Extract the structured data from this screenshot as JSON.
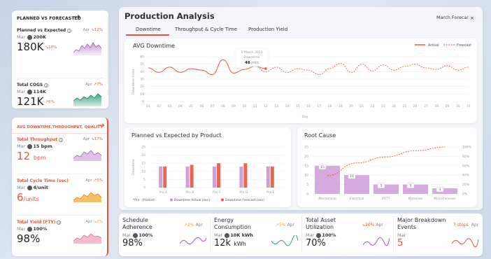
{
  "left": {
    "card1": {
      "title": "PLANNED VS FORECASTED",
      "kpis": [
        {
          "name": "Planned vs Expected",
          "apr_label": "Apr",
          "apr_change": "12%",
          "mar_label": "Mar",
          "mar_value": "200K",
          "value": "180K",
          "value_change": "10%"
        },
        {
          "name": "Total COGS",
          "apr_label": "Apr",
          "apr_change": "7%",
          "mar_label": "Mar",
          "mar_value": "114K",
          "value": "121K",
          "value_change": "6%"
        }
      ]
    },
    "card2": {
      "title": "AVG DOWNTIME,THROUGHPUT, QUALITY",
      "kpis": [
        {
          "name": "Total Throughput",
          "apr_label": "Apr",
          "apr_change": "17%",
          "mar_label": "Mar",
          "mar_value": "15 bpm",
          "value": "12",
          "unit": "bpm"
        },
        {
          "name": "Total Cycle Time (sec)",
          "apr_label": "Apr",
          "apr_change": "5%",
          "mar_label": "Mar",
          "mar_value": "4/unit",
          "value": "6",
          "unit": "/units"
        },
        {
          "name": "Total Yield (FTY)",
          "apr_label": "Apr",
          "apr_change": "2%",
          "mar_label": "Mar",
          "mar_value": "100%",
          "value": "98%"
        }
      ]
    }
  },
  "main": {
    "title": "Production Analysis",
    "forecast_label": "March Forecast",
    "close_icon": "×",
    "tabs": [
      {
        "label": "Downtime"
      },
      {
        "label": "Throughput & Cycle Time"
      },
      {
        "label": "Production Yield"
      }
    ]
  },
  "downtime_chart": {
    "title": "AVG Downtime",
    "legend_actual": "Actual",
    "legend_forecast": "Forecast",
    "tooltip_date": "5 March 2023",
    "tooltip_label": "Downtime",
    "tooltip_value": "48",
    "tooltip_unit": "min",
    "ylabel": "Downtime (min)",
    "xlabel": "Day"
  },
  "product_chart": {
    "title": "Planned vs Expected by Product",
    "ylabel": "Downtime",
    "footnote": "*Pro - Product",
    "legend_actual": "Downtime Actual (sec)",
    "legend_forecast": "Downtime Forecast (sec)"
  },
  "root_chart": {
    "title": "Root Cause"
  },
  "bottom": [
    {
      "title": "Schedule Adherence",
      "apr_change": "2%",
      "apr_label": "Apr",
      "mar_label": "Mar",
      "mar_value": "100%",
      "value": "98%"
    },
    {
      "title": "Energy Consumption",
      "apr_change": "5%",
      "apr_label": "Apr",
      "mar_label": "Mar",
      "mar_value": "10K kWh",
      "value": "12k",
      "unit": "kWh"
    },
    {
      "title": "Total Asset Utilization",
      "apr_change": "20%",
      "apr_label": "Apr",
      "mar_label": "Mar",
      "mar_value": "100%",
      "value": "70%"
    },
    {
      "title": "Major Breakdown Events",
      "apr_change": "7 stops",
      "apr_label": "Apr",
      "mar_label": "Mar",
      "mar_value": "",
      "value": "5"
    }
  ],
  "colors": {
    "accent": "#e8553e",
    "purple": "#c58fd0",
    "green": "#2e9f7a",
    "orange": "#f2a22a",
    "pink": "#f0a0b0"
  },
  "chart_data": [
    {
      "type": "line",
      "title": "AVG Downtime",
      "xlabel": "Day",
      "ylabel": "Downtime (min)",
      "x": [
        "01",
        "02",
        "03",
        "04",
        "05",
        "06",
        "07",
        "08",
        "09",
        "10",
        "11",
        "12",
        "13",
        "14",
        "15",
        "16",
        "17",
        "18",
        "19",
        "20",
        "21",
        "22",
        "23",
        "24",
        "25",
        "26",
        "27",
        "28",
        "29",
        "30",
        "31"
      ],
      "ylim": [
        0,
        60
      ],
      "yticks": [
        0,
        10,
        20,
        30,
        40,
        50,
        60
      ],
      "series": [
        {
          "name": "Actual",
          "values": [
            45,
            39,
            46,
            39,
            44,
            42,
            36,
            56,
            38,
            43,
            47,
            44
          ]
        },
        {
          "name": "Forecast",
          "values": [
            null,
            null,
            null,
            null,
            null,
            null,
            null,
            null,
            null,
            null,
            47,
            40,
            46,
            39,
            44,
            42,
            36,
            44,
            51,
            39,
            50,
            41,
            49,
            42,
            47,
            50,
            45,
            43,
            48,
            42,
            46
          ]
        }
      ],
      "legend": "top-right"
    },
    {
      "type": "bar",
      "title": "Planned vs Expected by Product",
      "ylabel": "Downtime",
      "categories": [
        "Pro A",
        "Pro B",
        "Pro C",
        "Pro D",
        "Pro E"
      ],
      "ylim": [
        0,
        25
      ],
      "yticks": [
        0,
        5,
        10,
        15,
        20,
        25
      ],
      "series": [
        {
          "name": "Downtime Actual (sec)",
          "values": [
            13,
            13,
            13,
            13,
            13
          ]
        },
        {
          "name": "Downtime Forecast (sec)",
          "values": [
            13,
            14,
            15,
            15,
            13
          ]
        }
      ],
      "legend": "bottom"
    },
    {
      "type": "bar",
      "title": "Root Cause",
      "categories": [
        "Mechanical",
        "Electrical",
        "MTTF",
        "Materials",
        "Miscellaneous"
      ],
      "values": [
        15,
        10,
        5,
        5,
        3
      ],
      "ylim": [
        0,
        25
      ],
      "yticks": [
        0,
        5,
        10,
        15,
        20,
        25
      ],
      "y2ticks": [
        "0%",
        "20%",
        "40%",
        "60%",
        "80%",
        "100%"
      ],
      "cumulative_percent": [
        39,
        66,
        79,
        92,
        100
      ]
    }
  ]
}
